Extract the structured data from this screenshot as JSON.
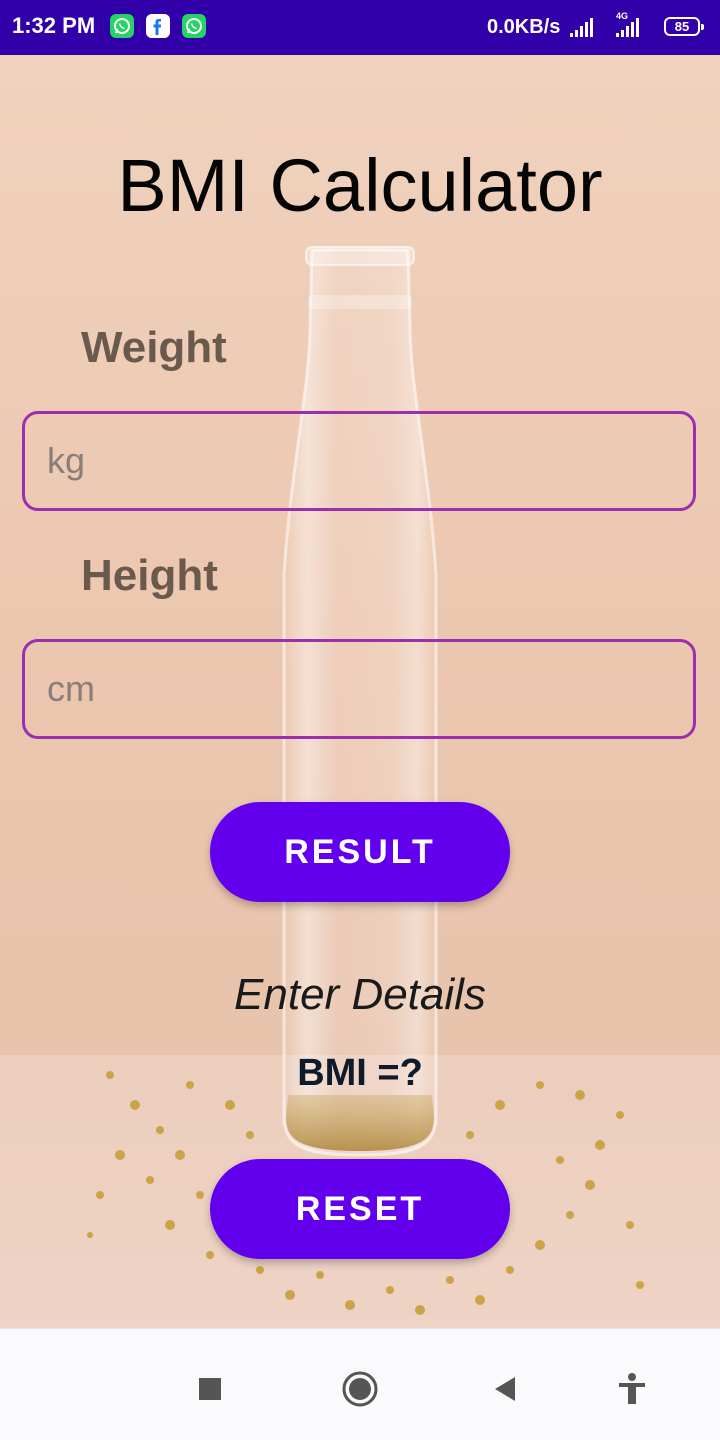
{
  "status_bar": {
    "time": "1:32 PM",
    "notifications": [
      "whatsapp-icon",
      "facebook-icon",
      "whatsapp-icon"
    ],
    "network_speed": "0.0KB/s",
    "network_type": "4G",
    "battery_level": "85",
    "background": "#3200a8"
  },
  "app": {
    "title": "BMI Calculator",
    "weight": {
      "label": "Weight",
      "value": "",
      "placeholder": "kg"
    },
    "height": {
      "label": "Height",
      "value": "",
      "placeholder": "cm"
    },
    "result_button_label": "RESULT",
    "status_text": "Enter Details",
    "bmi_text": "BMI =?",
    "reset_button_label": "RESET",
    "accent_color": "#6200ee",
    "field_border_color": "#9b2fae"
  },
  "nav_bar": {
    "items": [
      "recents-icon",
      "home-icon",
      "back-icon",
      "accessibility-icon"
    ]
  }
}
